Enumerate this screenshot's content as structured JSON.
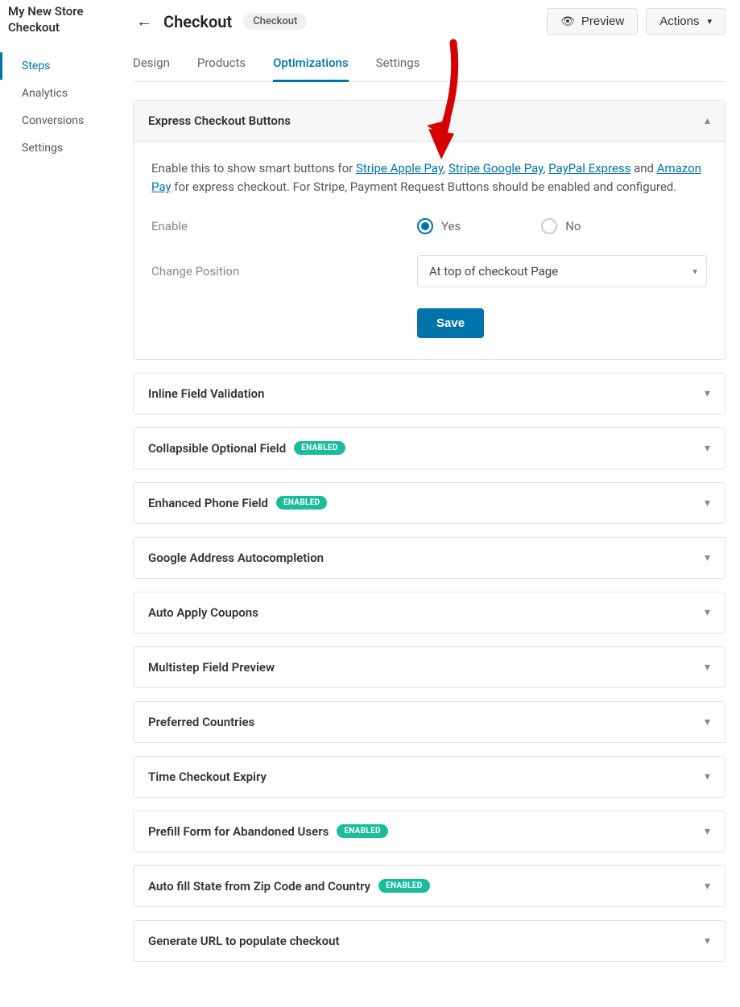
{
  "store": {
    "title": "My New Store\nCheckout"
  },
  "sidebar": {
    "items": [
      {
        "label": "Steps",
        "active": true
      },
      {
        "label": "Analytics",
        "active": false
      },
      {
        "label": "Conversions",
        "active": false
      },
      {
        "label": "Settings",
        "active": false
      }
    ]
  },
  "header": {
    "title": "Checkout",
    "badge": "Checkout",
    "preview": "Preview",
    "actions": "Actions"
  },
  "tabs": [
    {
      "label": "Design",
      "active": false
    },
    {
      "label": "Products",
      "active": false
    },
    {
      "label": "Optimizations",
      "active": true
    },
    {
      "label": "Settings",
      "active": false
    }
  ],
  "express": {
    "title": "Express Checkout Buttons",
    "desc_prefix": "Enable this to show smart buttons for ",
    "link_stripe_apple": "Stripe Apple Pay",
    "sep1": ", ",
    "link_stripe_google": "Stripe Google Pay",
    "sep2": ", ",
    "link_paypal": "PayPal Express",
    "sep_and": " and ",
    "link_amazon": "Amazon Pay",
    "desc_suffix": " for express checkout. For Stripe, Payment Request Buttons should be enabled and configured.",
    "enable_label": "Enable",
    "opt_yes": "Yes",
    "opt_no": "No",
    "position_label": "Change Position",
    "position_value": "At top of checkout Page",
    "save": "Save"
  },
  "sections": [
    {
      "title": "Inline Field Validation",
      "enabled": false
    },
    {
      "title": "Collapsible Optional Field",
      "enabled": true
    },
    {
      "title": "Enhanced Phone Field",
      "enabled": true
    },
    {
      "title": "Google Address Autocompletion",
      "enabled": false
    },
    {
      "title": "Auto Apply Coupons",
      "enabled": false
    },
    {
      "title": "Multistep Field Preview",
      "enabled": false
    },
    {
      "title": "Preferred Countries",
      "enabled": false
    },
    {
      "title": "Time Checkout Expiry",
      "enabled": false
    },
    {
      "title": "Prefill Form for Abandoned Users",
      "enabled": true
    },
    {
      "title": "Auto fill State from Zip Code and Country",
      "enabled": true
    },
    {
      "title": "Generate URL to populate checkout",
      "enabled": false
    }
  ],
  "badge_text": "ENABLED"
}
